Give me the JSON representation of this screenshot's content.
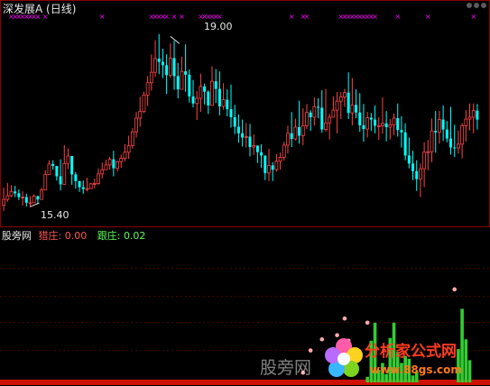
{
  "top_panel": {
    "title": "深发展A (日线)"
  },
  "bottom_panel": {
    "indicator_name": "股旁网",
    "item1_label": "猎庄:",
    "item1_value": "0.00",
    "item2_label": "跟庄:",
    "item2_value": "0.02"
  },
  "watermark": {
    "center_text": "股旁网",
    "logo_text": "分析家公式网",
    "logo_url": "www.88gs.com"
  },
  "colors": {
    "up": "#ff4444",
    "down": "#00ffff",
    "panel_border": "#8b0000",
    "marker": "#ff00ff",
    "dot": "#ffaaaa",
    "bar": "#33cc33",
    "base": "#cc1100"
  },
  "chart_data": [
    {
      "type": "candlestick",
      "annotations": [
        {
          "text": "19.00",
          "x": 44,
          "y": 19.0
        },
        {
          "text": "15.40",
          "x": 7,
          "y": 15.4
        }
      ],
      "ylim": [
        15.0,
        19.35
      ],
      "x_count": 126,
      "signal_marks": [
        2,
        3,
        4,
        5,
        6,
        7,
        8,
        9,
        11,
        26,
        39,
        40,
        41,
        42,
        43,
        45,
        47,
        52,
        53,
        54,
        55,
        56,
        57,
        76,
        79,
        80,
        89,
        90,
        91,
        92,
        93,
        94,
        95,
        96,
        97,
        98,
        104,
        112,
        124
      ],
      "highs": [
        15.8,
        15.9,
        15.85,
        15.84,
        15.76,
        15.72,
        15.67,
        15.62,
        15.66,
        15.63,
        15.8,
        16.17,
        16.38,
        16.38,
        16.25,
        16.4,
        16.7,
        16.63,
        16.4,
        16.13,
        15.94,
        15.95,
        16.01,
        15.9,
        15.99,
        16.21,
        16.33,
        16.39,
        16.45,
        16.58,
        16.37,
        16.5,
        16.72,
        16.9,
        17.06,
        17.4,
        17.72,
        17.83,
        18.16,
        18.62,
        18.92,
        19.05,
        18.74,
        18.62,
        18.85,
        18.91,
        18.44,
        18.57,
        18.83,
        18.3,
        18.08,
        17.84,
        18.21,
        18.0,
        17.86,
        18.37,
        18.31,
        18.26,
        18.01,
        17.88,
        17.98,
        17.55,
        17.35,
        17.24,
        17.17,
        17.15,
        16.93,
        16.67,
        16.72,
        16.46,
        16.62,
        16.34,
        16.51,
        16.54,
        16.77,
        17.11,
        17.4,
        17.26,
        17.64,
        17.48,
        17.57,
        17.44,
        17.71,
        17.69,
        17.86,
        17.89,
        17.36,
        17.73,
        17.82,
        17.82,
        17.89,
        18.24,
        18.12,
        17.88,
        17.8,
        17.57,
        17.4,
        17.38,
        17.54,
        17.29,
        17.71,
        17.42,
        17.25,
        17.37,
        17.58,
        17.31,
        17.16,
        16.86,
        16.58,
        16.38,
        16.31,
        16.76,
        16.81,
        17.26,
        17.42,
        17.42,
        17.54,
        17.21,
        17.51,
        17.13,
        17.01,
        17.17,
        17.44,
        17.58,
        17.58,
        17.57
      ],
      "lows": [
        15.31,
        15.5,
        15.6,
        15.6,
        15.54,
        15.42,
        15.4,
        15.38,
        15.52,
        15.45,
        15.58,
        15.82,
        16.08,
        16.18,
        15.95,
        15.74,
        15.93,
        16.19,
        15.86,
        15.78,
        15.71,
        15.67,
        15.72,
        15.8,
        15.79,
        15.86,
        16.0,
        16.19,
        16.18,
        16.04,
        16.14,
        16.22,
        16.36,
        16.41,
        16.63,
        16.86,
        17.09,
        17.38,
        17.53,
        17.85,
        18.14,
        18.2,
        18.12,
        17.78,
        18.12,
        17.87,
        17.69,
        17.97,
        17.83,
        17.6,
        17.5,
        17.23,
        17.4,
        17.56,
        17.36,
        17.61,
        17.59,
        17.33,
        17.45,
        17.31,
        17.07,
        16.93,
        16.75,
        16.67,
        16.65,
        16.46,
        16.49,
        16.32,
        16.22,
        15.96,
        15.94,
        15.94,
        16.14,
        16.18,
        16.37,
        16.52,
        16.66,
        16.8,
        16.73,
        16.7,
        17.04,
        17.0,
        17.11,
        17.27,
        16.96,
        16.99,
        16.82,
        17.28,
        16.95,
        17.25,
        17.51,
        17.25,
        17.12,
        17.27,
        16.98,
        16.77,
        16.86,
        17.0,
        16.95,
        16.81,
        16.94,
        16.78,
        16.82,
        16.91,
        16.88,
        16.65,
        16.38,
        16.21,
        15.96,
        15.73,
        15.6,
        15.81,
        16.17,
        16.34,
        16.54,
        16.73,
        16.79,
        16.76,
        16.5,
        16.45,
        16.52,
        16.42,
        16.77,
        17.01,
        16.95,
        17.03
      ],
      "closes": [
        15.55,
        15.63,
        15.72,
        15.68,
        15.6,
        15.6,
        15.48,
        15.48,
        15.62,
        15.55,
        15.75,
        16.08,
        16.3,
        16.26,
        16.04,
        15.87,
        16.31,
        16.47,
        16.08,
        15.94,
        15.81,
        15.77,
        15.78,
        15.88,
        15.89,
        16.09,
        16.18,
        16.28,
        16.4,
        16.21,
        16.35,
        16.42,
        16.55,
        16.69,
        16.98,
        17.27,
        17.41,
        17.76,
        18.02,
        18.24,
        18.53,
        18.46,
        18.39,
        18.18,
        18.54,
        18.16,
        17.88,
        18.26,
        18.19,
        17.73,
        17.58,
        17.69,
        17.94,
        17.83,
        17.54,
        18.05,
        17.89,
        17.52,
        17.66,
        17.46,
        17.29,
        17.09,
        16.95,
        16.86,
        16.88,
        16.66,
        16.69,
        16.55,
        16.48,
        16.11,
        16.27,
        16.18,
        16.36,
        16.44,
        16.7,
        16.95,
        16.83,
        17.08,
        16.9,
        17.11,
        17.39,
        17.29,
        17.51,
        17.49,
        17.03,
        17.17,
        17.29,
        17.44,
        17.63,
        17.72,
        17.81,
        17.38,
        17.55,
        17.39,
        17.12,
        17.04,
        17.28,
        17.24,
        17.11,
        17.11,
        17.16,
        17.08,
        17.13,
        17.27,
        17.02,
        16.97,
        16.48,
        16.31,
        16.15,
        15.98,
        16.2,
        16.55,
        16.56,
        17.0,
        16.97,
        17.24,
        17.03,
        16.84,
        16.65,
        16.64,
        16.72,
        17.11,
        17.25,
        17.29,
        17.43,
        17.24
      ]
    },
    {
      "type": "bar",
      "ylim": [
        0,
        1
      ],
      "x": [
        96,
        97,
        98,
        99,
        100,
        101,
        102,
        103,
        104,
        105,
        106,
        107,
        108,
        109,
        120,
        121,
        122,
        123
      ],
      "values": [
        0.04,
        0.3,
        0.43,
        0.09,
        0.14,
        0.06,
        0.32,
        0.43,
        0.22,
        0.14,
        0.19,
        0.17,
        0.05,
        0.08,
        0.24,
        0.53,
        0.31,
        0.16
      ],
      "dot_x": [
        79,
        81,
        84,
        88,
        90,
        91,
        94,
        96,
        119
      ],
      "dot_y": [
        0.07,
        0.23,
        0.31,
        0.34,
        0.46,
        0.3,
        0.18,
        0.43,
        0.67
      ],
      "base_values": [
        0.02
      ]
    }
  ]
}
